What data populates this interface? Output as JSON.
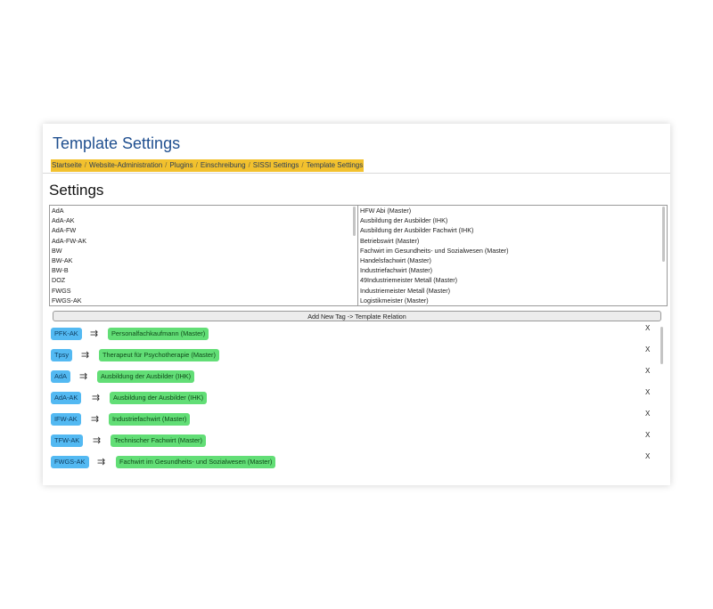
{
  "page_title": "Template Settings",
  "breadcrumb": [
    "Startseite",
    "Website-Administration",
    "Plugins",
    "Einschreibung",
    "SISSI Settings",
    "Template Settings"
  ],
  "breadcrumb_separator": "/",
  "section_title": "Settings",
  "tags_list": [
    "AdA",
    "AdA-AK",
    "AdA-FW",
    "AdA-FW-AK",
    "BW",
    "BW-AK",
    "BW-B",
    "DOZ",
    "FWGS",
    "FWGS-AK"
  ],
  "templates_list": [
    "HFW Abi (Master)",
    "Ausbildung der Ausbilder (IHK)",
    "Ausbildung der Ausbilder Fachwirt (IHK)",
    "Betriebswirt (Master)",
    "Fachwirt im Gesundheits- und Sozialwesen (Master)",
    "Handelsfachwirt (Master)",
    "Industriefachwirt (Master)",
    "49Industriemeister Metall (Master)",
    "Industriemeister Metall (Master)",
    "Logistikmeister (Master)"
  ],
  "add_button_label": "Add New Tag -> Template Relation",
  "arrow_glyph": "⇉",
  "remove_label": "X",
  "relations": [
    {
      "tag": "PFK-AK",
      "template": "Personalfachkaufmann (Master)"
    },
    {
      "tag": "Tpsy",
      "template": "Therapeut für Psychotherapie (Master)"
    },
    {
      "tag": "AdA",
      "template": "Ausbildung der Ausbilder (IHK)"
    },
    {
      "tag": "AdA-AK",
      "template": "Ausbildung der Ausbilder (IHK)"
    },
    {
      "tag": "IFW-AK",
      "template": "Industriefachwirt (Master)"
    },
    {
      "tag": "TFW-AK",
      "template": "Technischer Fachwirt (Master)"
    },
    {
      "tag": "FWGS-AK",
      "template": "Fachwirt im Gesundheits- und Sozialwesen (Master)"
    }
  ],
  "colors": {
    "tag_blue": "#53b9f2",
    "template_green": "#62de76",
    "breadcrumb_bg": "#f2c12e",
    "title_blue": "#1f4f8f"
  }
}
